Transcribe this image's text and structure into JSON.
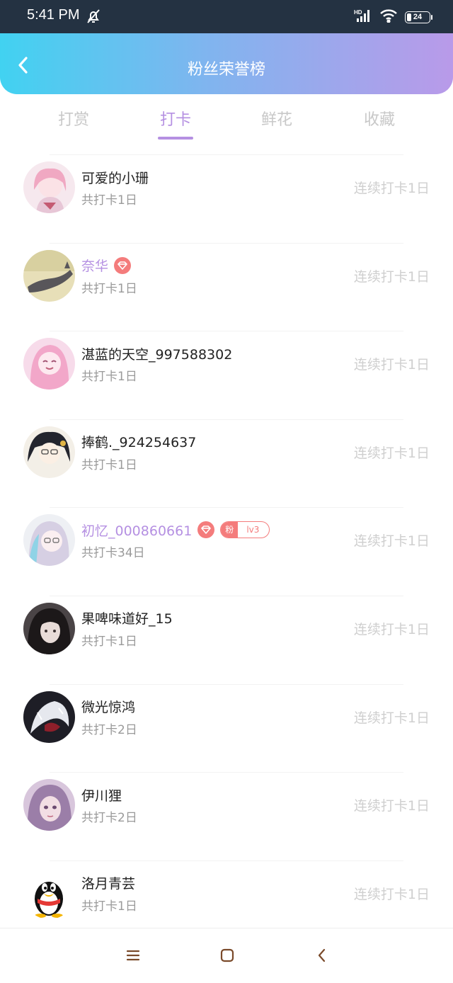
{
  "status_bar": {
    "time": "5:41 PM",
    "battery": "24",
    "icons": [
      "bell-off-icon",
      "hd-signal-icon",
      "wifi-icon",
      "battery-icon"
    ]
  },
  "header": {
    "title": "粉丝荣誉榜",
    "back_icon": "chevron-left-icon",
    "gradient": [
      "#41d2f1",
      "#b99ae9"
    ]
  },
  "tabs": [
    {
      "label": "打赏",
      "active": false
    },
    {
      "label": "打卡",
      "active": true
    },
    {
      "label": "鲜花",
      "active": false
    },
    {
      "label": "收藏",
      "active": false
    }
  ],
  "colors": {
    "accent": "#b590e2",
    "badge": "#f47c7c",
    "muted": "#9a9a9a",
    "streak": "#cfcfcf"
  },
  "list": [
    {
      "name": "可爱的小珊",
      "total": "共打卡1日",
      "streak": "连续打卡1日",
      "vip": false,
      "fan_badge": false
    },
    {
      "name": "奈华",
      "total": "共打卡1日",
      "streak": "连续打卡1日",
      "vip": true,
      "fan_badge": false
    },
    {
      "name": "湛蓝的天空_997588302",
      "total": "共打卡1日",
      "streak": "连续打卡1日",
      "vip": false,
      "fan_badge": false
    },
    {
      "name": "捧鹤._924254637",
      "total": "共打卡1日",
      "streak": "连续打卡1日",
      "vip": false,
      "fan_badge": false
    },
    {
      "name": "初忆_000860661",
      "total": "共打卡34日",
      "streak": "连续打卡1日",
      "vip": true,
      "fan_badge": true,
      "fan_label": "粉",
      "fan_level": "lv3"
    },
    {
      "name": "果啤味道好_15",
      "total": "共打卡1日",
      "streak": "连续打卡1日",
      "vip": false,
      "fan_badge": false
    },
    {
      "name": "微光惊鸿",
      "total": "共打卡2日",
      "streak": "连续打卡1日",
      "vip": false,
      "fan_badge": false
    },
    {
      "name": "伊川狸",
      "total": "共打卡2日",
      "streak": "连续打卡1日",
      "vip": false,
      "fan_badge": false
    },
    {
      "name": "洛月青芸",
      "total": "共打卡1日",
      "streak": "连续打卡1日",
      "vip": false,
      "fan_badge": false
    }
  ],
  "nav_bar": {
    "icons": [
      "menu-icon",
      "home-square-icon",
      "back-chevron-icon"
    ]
  }
}
